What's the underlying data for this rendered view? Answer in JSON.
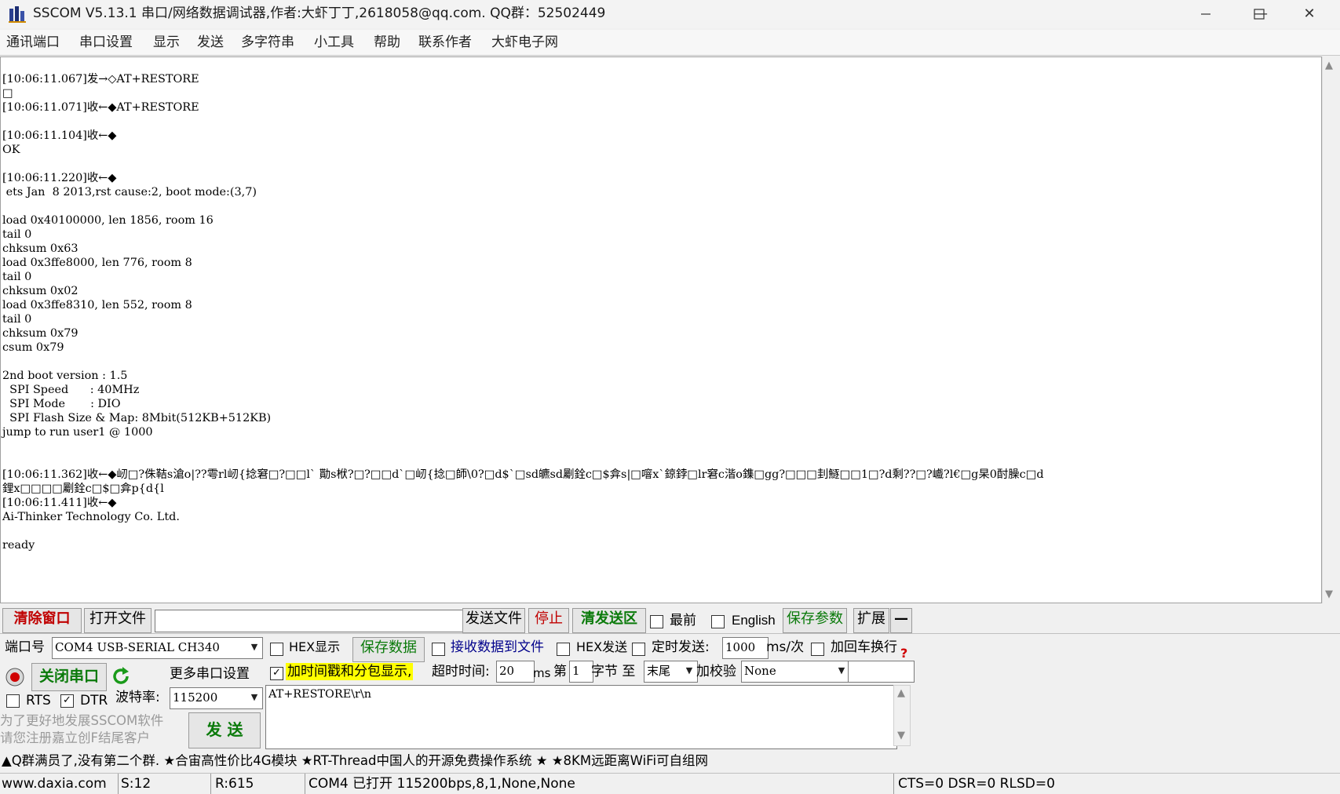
{
  "window": {
    "title": "SSCOM V5.13.1 串口/网络数据调试器,作者:大虾丁丁,2618058@qq.com. QQ群：52502449",
    "minimize": "—",
    "maximize": "☐",
    "close": "✕"
  },
  "menu": [
    "通讯端口",
    "串口设置",
    "显示",
    "发送",
    "多字符串",
    "小工具",
    "帮助",
    "联系作者",
    "大虾电子网"
  ],
  "receive": {
    "lines": [
      "[10:06:11.067]发→◇AT+RESTORE",
      "□",
      "[10:06:11.071]收←◆AT+RESTORE",
      "",
      "[10:06:11.104]收←◆",
      "OK",
      "",
      "[10:06:11.220]收←◆",
      " ets Jan  8 2013,rst cause:2, boot mode:(3,7)",
      "",
      "load 0x40100000, len 1856, room 16",
      "tail 0",
      "chksum 0x63",
      "load 0x3ffe8000, len 776, room 8",
      "tail 0",
      "chksum 0x02",
      "load 0x3ffe8310, len 552, room 8",
      "tail 0",
      "chksum 0x79",
      "csum 0x79",
      "",
      "2nd boot version : 1.5",
      "  SPI Speed      : 40MHz",
      "  SPI Mode       : DIO",
      "  SPI Flash Size & Map: 8Mbit(512KB+512KB)",
      "jump to run user1 @ 1000",
      "",
      "",
      "[10:06:11.362]收←◆屻□?侏鞊s滄o|??雩rl屻{捻窘□?□□l` 勩s栿?□?□□d`□屻{捻□師\\0?□d$`□sd皫sd劚銓c□$弇s|□噾x`鍄鋍□lr窘c湝o鏶□gg?□□□刲鱁□□1□?d剩??□?巇?l€□g杲0酎臊c□d",
      "鋰x□□□□劚銓c□$□弇p{d{l",
      "[10:06:11.411]收←◆",
      "Ai-Thinker Technology Co. Ltd.",
      "",
      "ready"
    ]
  },
  "toolbar": {
    "clear": "清除窗口",
    "open_file": "打开文件",
    "file_path": "",
    "send_file": "发送文件",
    "stop": "停止",
    "clear_send": "清发送区",
    "topmost": "最前",
    "english": "English",
    "save_params": "保存参数",
    "expand": "扩展",
    "collapse": "—"
  },
  "port": {
    "label": "端口号",
    "value": "COM4 USB-SERIAL CH340",
    "close_port": "关闭串口",
    "more_settings": "更多串口设置",
    "rts": "RTS",
    "dtr": "DTR",
    "baud_label": "波特率:",
    "baud_value": "115200",
    "promo": [
      "为了更好地发展SSCOM软件",
      "请您注册嘉立创F结尾客户"
    ],
    "send": "发  送"
  },
  "options": {
    "hex_display": "HEX显示",
    "save_data": "保存数据",
    "recv_to_file": "接收数据到文件",
    "hex_send": "HEX发送",
    "timed_send": "定时发送:",
    "interval": "1000",
    "interval_unit": "ms/次",
    "add_crlf": "加回车换行",
    "timestamp": "加时间戳和分包显示,",
    "timeout_label": "超时时间:",
    "timeout": "20",
    "timeout_unit": "ms",
    "byte_prefix": "第",
    "byte_index": "1",
    "byte_suffix": "字节 至",
    "byte_end": "末尾",
    "checksum_label": "加校验",
    "checksum": "None",
    "checksum_result": ""
  },
  "send_text": "AT+RESTORE\\r\\n",
  "ticker": "▲Q群满员了,没有第二个群. ★合宙高性价比4G模块 ★RT-Thread中国人的开源免费操作系统 ★ ★8KM远距离WiFi可自组网",
  "status": {
    "site": "www.daxia.com",
    "sent": "S:12",
    "received": "R:615",
    "port_state": "COM4 已打开  115200bps,8,1,None,None",
    "lines": "CTS=0 DSR=0 RLSD=0"
  },
  "colors": {
    "accent_red": "#c00000",
    "accent_green": "#0a7a0a",
    "accent_blue": "#00008b",
    "highlight_yellow": "#ffff00"
  }
}
